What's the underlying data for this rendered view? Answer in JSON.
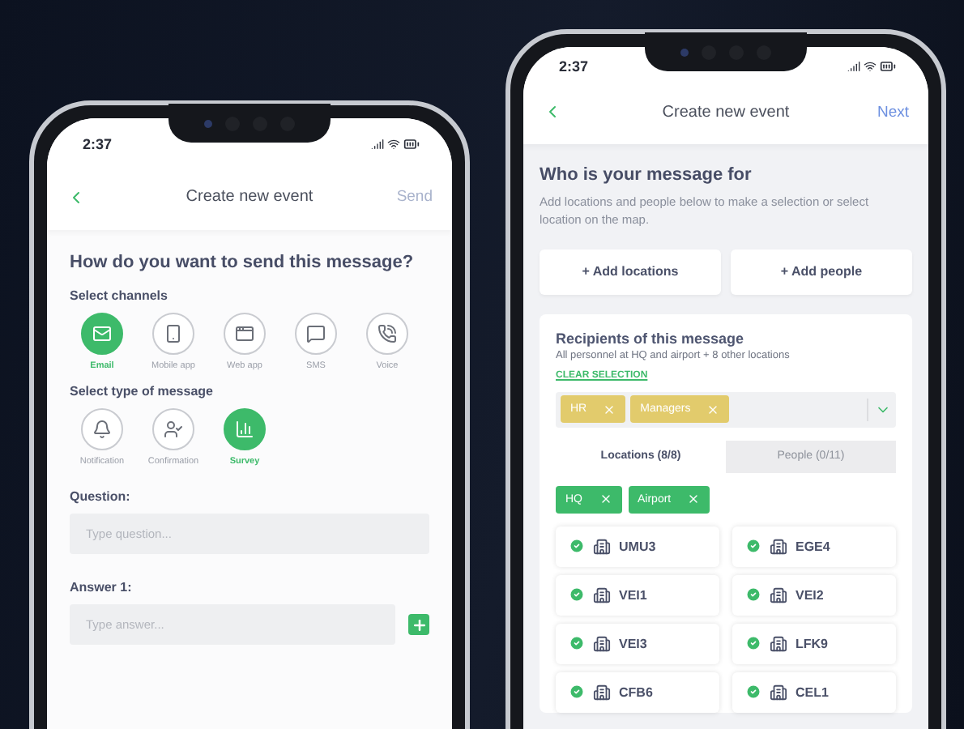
{
  "left_phone": {
    "status_bar": {
      "time": "2:37"
    },
    "header": {
      "title": "Create new event",
      "action": {
        "label": "Send",
        "disabled": true
      }
    },
    "heading": "How do you want to send this message?",
    "channels": {
      "label": "Select channels",
      "items": [
        {
          "label": "Email",
          "kind": "email",
          "selected": true
        },
        {
          "label": "Mobile app",
          "kind": "mobile",
          "selected": false
        },
        {
          "label": "Web app",
          "kind": "web",
          "selected": false
        },
        {
          "label": "SMS",
          "kind": "sms",
          "selected": false
        },
        {
          "label": "Voice",
          "kind": "voice",
          "selected": false
        }
      ]
    },
    "message_types": {
      "label": "Select type of message",
      "items": [
        {
          "label": "Notification",
          "kind": "notification",
          "selected": false
        },
        {
          "label": "Confirmation",
          "kind": "confirmation",
          "selected": false
        },
        {
          "label": "Survey",
          "kind": "survey",
          "selected": true
        }
      ]
    },
    "fields": [
      {
        "label": "Question:",
        "placeholder": "Type question...",
        "kind": "text"
      },
      {
        "label": "Answer 1:",
        "placeholder": "Type answer...",
        "kind": "answer"
      }
    ]
  },
  "right_phone": {
    "status_bar": {
      "time": "2:37"
    },
    "header": {
      "title": "Create new event",
      "action": {
        "label": "Next",
        "disabled": false
      }
    },
    "heading": "Who is your message for",
    "description": "Add locations and people below to make a selection or select location on the map.",
    "buttons": [
      "+ Add locations",
      "+ Add people"
    ],
    "recipients": {
      "title": "Recipients of this message",
      "summary": "All personnel at HQ and airport + 8 other locations",
      "clear_link": "CLEAR SELECTION",
      "group_tags": [
        {
          "label": "HR"
        },
        {
          "label": "Managers"
        }
      ],
      "tabs": [
        {
          "label": "Locations (8/8)",
          "selected": true
        },
        {
          "label": "People (0/11)",
          "selected": false
        }
      ],
      "location_tags": [
        {
          "label": "HQ"
        },
        {
          "label": "Airport"
        }
      ],
      "locations": [
        {
          "code": "UMU3",
          "checked": true
        },
        {
          "code": "EGE4",
          "checked": true
        },
        {
          "code": "VEI1",
          "checked": true
        },
        {
          "code": "VEI2",
          "checked": true
        },
        {
          "code": "VEI3",
          "checked": true
        },
        {
          "code": "LFK9",
          "checked": true
        },
        {
          "code": "CFB6",
          "checked": true
        },
        {
          "code": "CEL1",
          "checked": true
        }
      ]
    }
  }
}
